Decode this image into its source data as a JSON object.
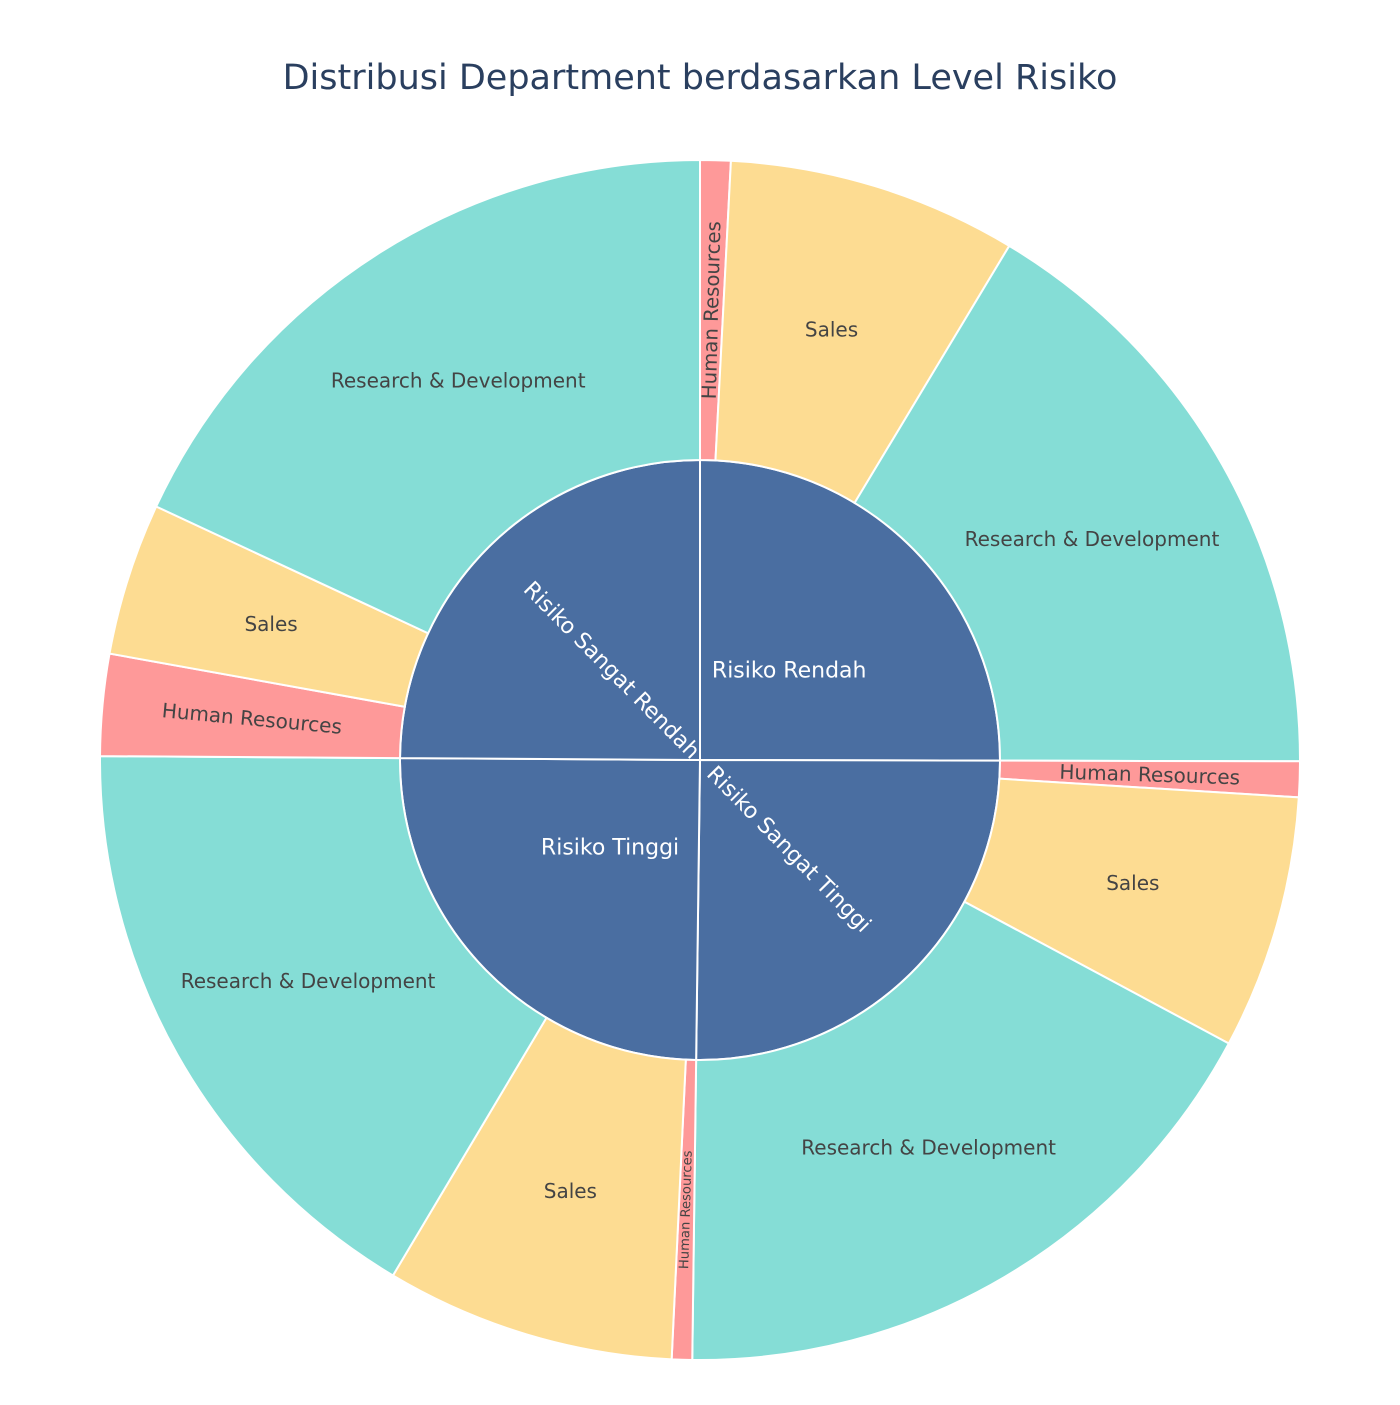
{
  "chart_data": {
    "type": "sunburst",
    "title": "Distribusi Department berdasarkan Level Risiko",
    "colors": {
      "inner": "#4a6ea1",
      "Research & Development": "#85ddd6",
      "Sales": "#fddc92",
      "Human Resources": "#fe9999",
      "inner_text": "#ffffff",
      "outer_text": "#444444",
      "stroke": "#ffffff"
    },
    "groups": [
      {
        "name": "Risiko Rendah",
        "children": [
          {
            "name": "Human Resources",
            "value": 6
          },
          {
            "name": "Sales",
            "value": 57
          },
          {
            "name": "Research & Development",
            "value": 120
          }
        ]
      },
      {
        "name": "Risiko Sangat Tinggi",
        "children": [
          {
            "name": "Human Resources",
            "value": 7
          },
          {
            "name": "Sales",
            "value": 50
          },
          {
            "name": "Research & Development",
            "value": 127
          }
        ]
      },
      {
        "name": "Risiko Tinggi",
        "children": [
          {
            "name": "Human Resources",
            "value": 4
          },
          {
            "name": "Sales",
            "value": 57
          },
          {
            "name": "Research & Development",
            "value": 121
          }
        ]
      },
      {
        "name": "Risiko Sangat Rendah",
        "children": [
          {
            "name": "Human Resources",
            "value": 20
          },
          {
            "name": "Sales",
            "value": 30
          },
          {
            "name": "Research & Development",
            "value": 132
          }
        ]
      }
    ]
  }
}
